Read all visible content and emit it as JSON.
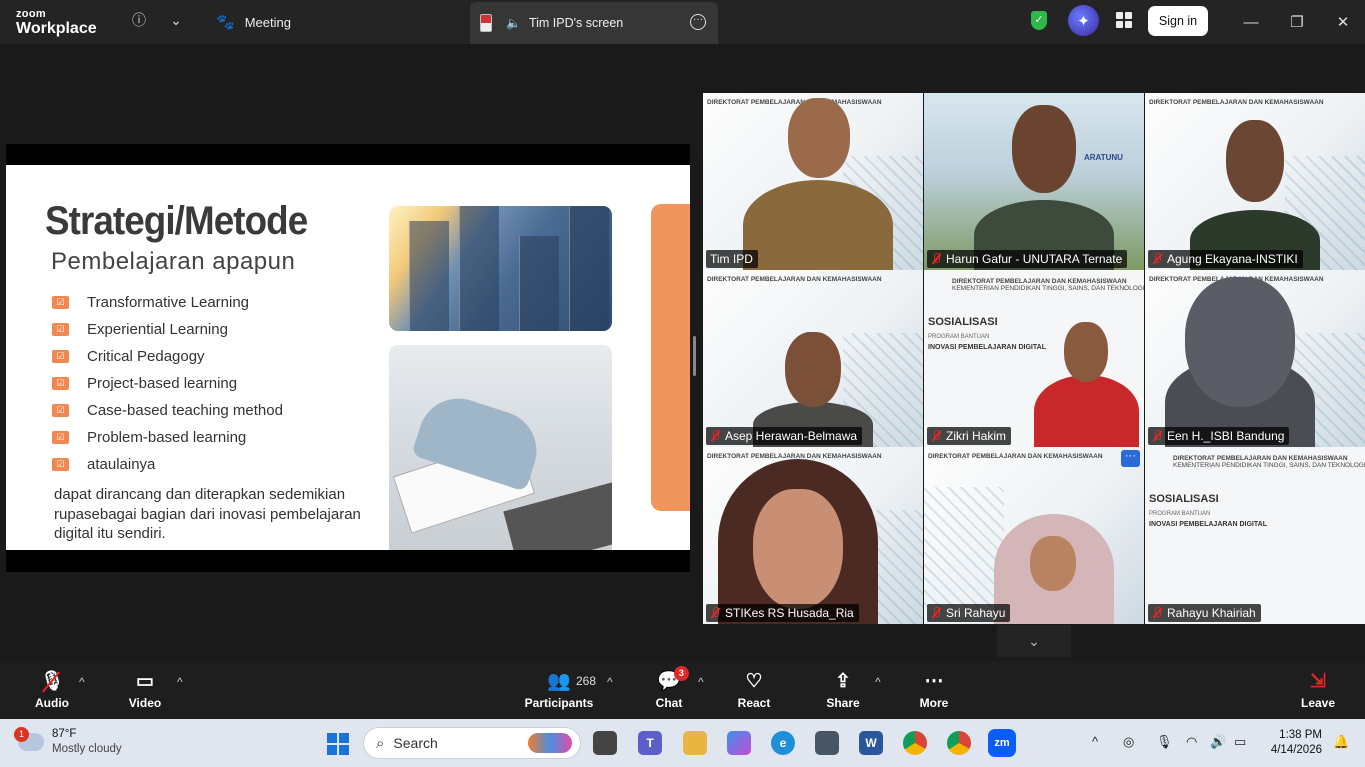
{
  "app": {
    "brand_top": "zoom",
    "brand_bottom": "Workplace"
  },
  "tabs": {
    "meeting": "Meeting",
    "screen": "Tim IPD's screen"
  },
  "topbar": {
    "signin": "Sign in"
  },
  "slide": {
    "title": "Strategi/Metode",
    "subtitle": "Pembelajaran apapun",
    "items": [
      "Transformative Learning",
      "Experiential Learning",
      "Critical Pedagogy",
      "Project-based learning",
      "Case-based teaching method",
      "Problem-based learning",
      "ataulainya"
    ],
    "body": "dapat dirancang dan diterapkan sedemikian rupasebagai bagian dari inovasi pembelajaran digital itu sendiri."
  },
  "gallery": [
    {
      "name": "Tim IPD",
      "muted": false,
      "active": true
    },
    {
      "name": "Harun Gafur - UNUTARA Ternate",
      "muted": true
    },
    {
      "name": "Agung Ekayana-INSTIKI",
      "muted": true
    },
    {
      "name": "Asep Herawan-Belmawa",
      "muted": true
    },
    {
      "name": "Zikri Hakim",
      "muted": true
    },
    {
      "name": "Een H._ISBI Bandung",
      "muted": true
    },
    {
      "name": "STIKes RS Husada_Ria",
      "muted": true
    },
    {
      "name": "Sri Rahayu",
      "muted": true
    },
    {
      "name": "Rahayu Khairiah",
      "muted": true
    }
  ],
  "tile_text": {
    "hdr1": "DIREKTORAT PEMBELAJARAN DAN KEMAHASISWAAN",
    "hdr2": "KEMENTERIAN PENDIDIKAN TINGGI, SAINS, DAN TEKNOLOGI",
    "sos": "SOSIALISASI",
    "prg": "PROGRAM BANTUAN",
    "ino": "INOVASI PEMBELAJARAN DIGITAL",
    "building": "ARATUNU"
  },
  "toolbar": {
    "audio": "Audio",
    "video": "Video",
    "participants": "Participants",
    "participants_count": "268",
    "chat": "Chat",
    "chat_badge": "3",
    "react": "React",
    "share": "Share",
    "more": "More",
    "leave": "Leave"
  },
  "taskbar": {
    "weather_temp": "87°F",
    "weather_desc": "Mostly cloudy",
    "weather_badge": "1",
    "search": "Search",
    "time": "1:38 PM",
    "date": "4/14/2026"
  },
  "colors": {
    "accent_green": "#3ad07a",
    "muted_red": "#e02828",
    "slide_orange": "#f0955c"
  }
}
